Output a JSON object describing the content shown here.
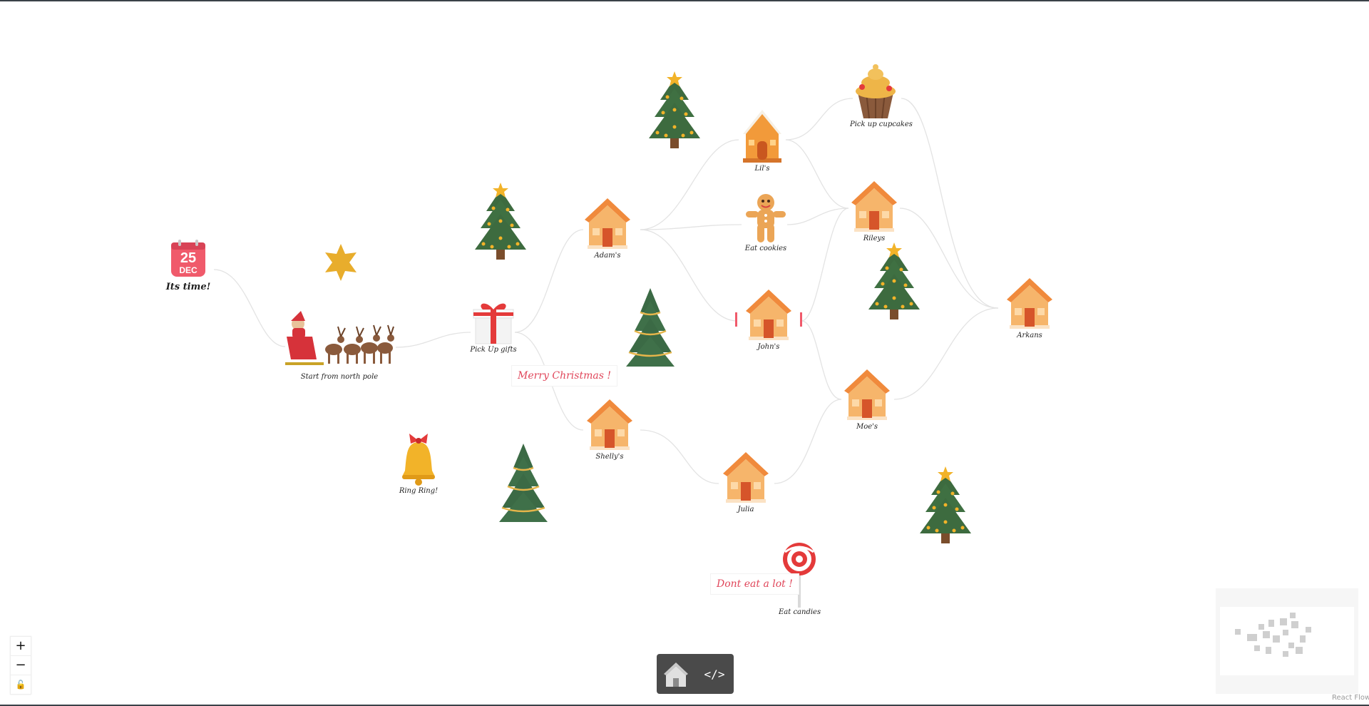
{
  "canvas": {
    "nodes": {
      "its_time": {
        "day": "25",
        "month": "DEC",
        "label": "Its time!"
      },
      "start": {
        "label": "Start from north pole"
      },
      "pickup_gifts": {
        "label": "Pick Up gifts"
      },
      "ring": {
        "label": "Ring Ring!"
      },
      "adams": {
        "label": "Adam's"
      },
      "shellys": {
        "label": "Shelly's"
      },
      "lils": {
        "label": "Lil's"
      },
      "eat_cookies": {
        "label": "Eat cookies"
      },
      "johns": {
        "label": "John's"
      },
      "julia": {
        "label": "Julia"
      },
      "pickup_cupcakes": {
        "label": "Pick up cupcakes"
      },
      "rileys": {
        "label": "Rileys"
      },
      "moes": {
        "label": "Moe's"
      },
      "arkans": {
        "label": "Arkans"
      },
      "eat_candies": {
        "label": "Eat candies"
      }
    },
    "notes": {
      "merry": "Merry Christmas !",
      "dont_eat": "Dont eat a lot !"
    }
  },
  "controls": {
    "zoom_in": "+",
    "zoom_out": "−",
    "lock": "🔓"
  },
  "toolbar": {
    "code_label": "</>"
  },
  "attribution": "React Flow",
  "colors": {
    "accent": "#f05a6b",
    "house_roof": "#f08a3c",
    "house_wall": "#f6b56b",
    "tree": "#3d6b3f",
    "star": "#e8ad2c",
    "toolbar_bg": "#4a4a4a"
  }
}
